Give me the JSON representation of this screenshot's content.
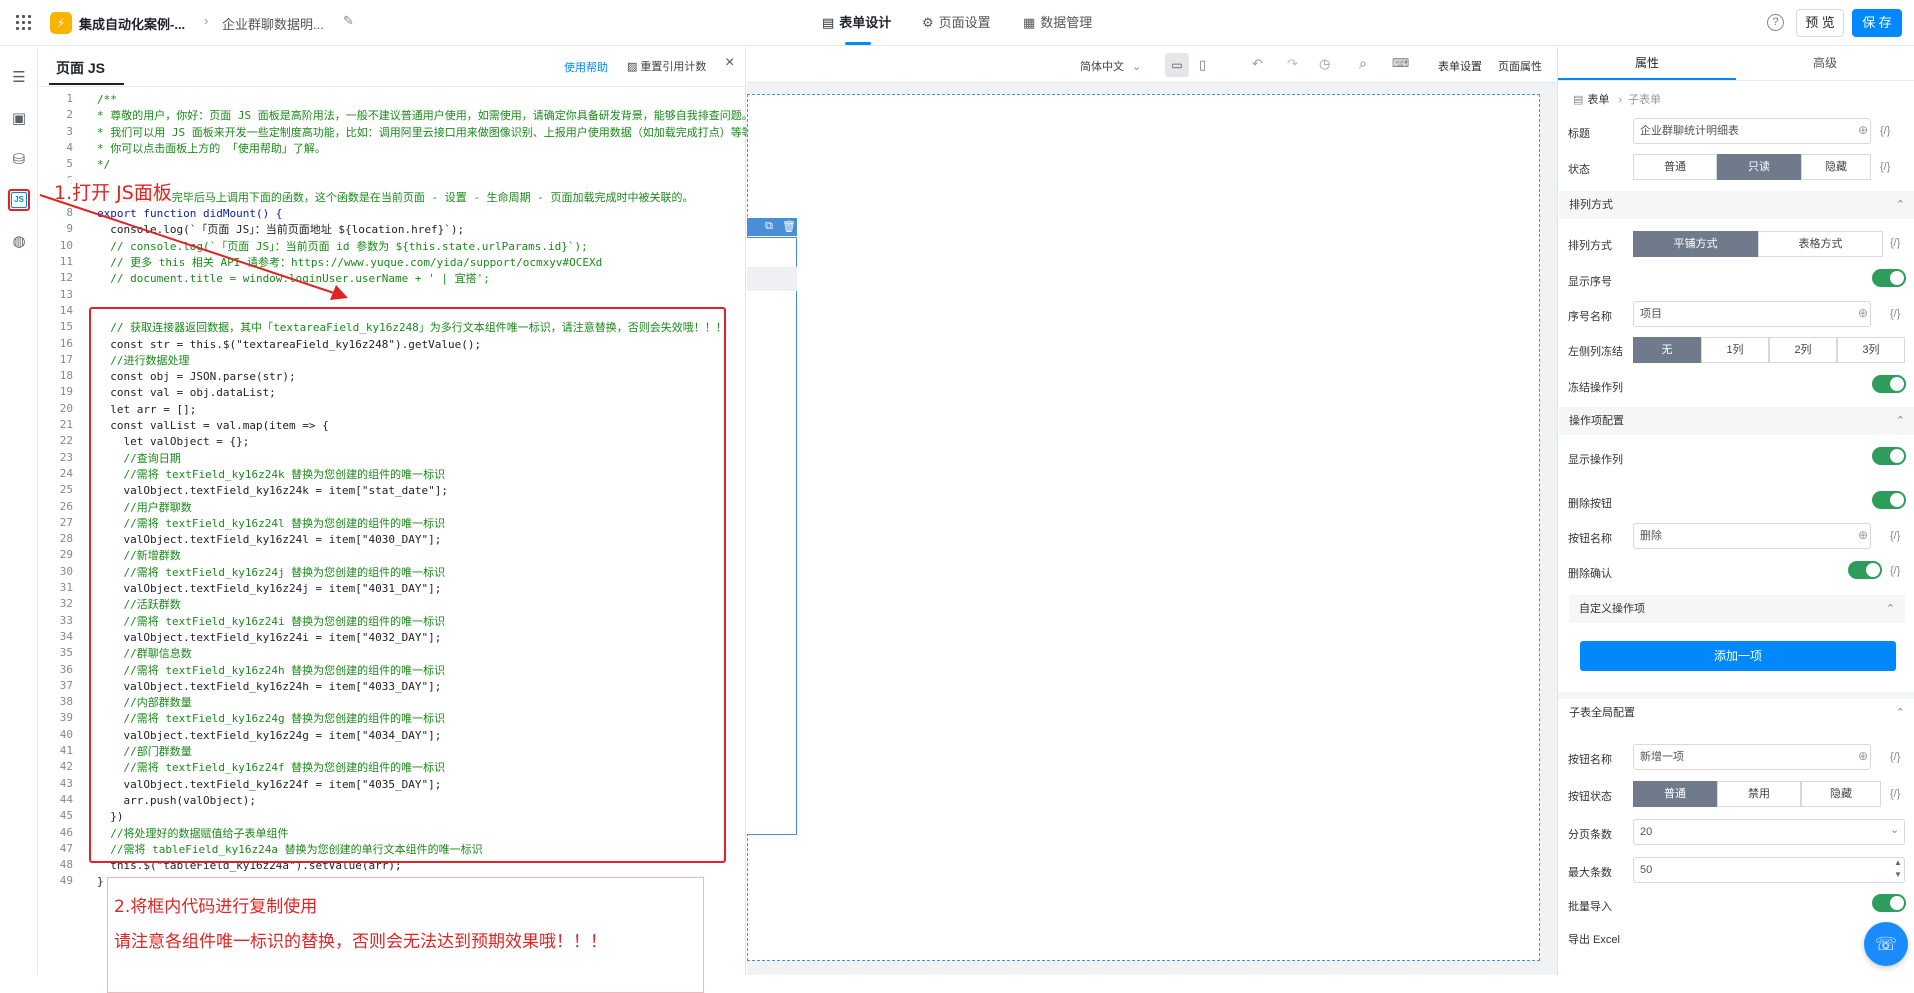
{
  "topbar": {
    "app_name": "集成自动化案例-...",
    "form_name": "企业群聊数据明...",
    "tabs": [
      "表单设计",
      "页面设置",
      "数据管理"
    ],
    "help_glyph": "?",
    "preview_label": "预 览",
    "save_label": "保 存"
  },
  "jspanel": {
    "title": "页面 JS",
    "help_link": "使用帮助",
    "reset_label": "重置引用计数",
    "close_glyph": "×",
    "line_numbers": [
      "1",
      "2",
      "3",
      "4",
      "5",
      "6",
      "7",
      "8",
      "9",
      "10",
      "11",
      "12",
      "13",
      "14",
      "15",
      "16",
      "17",
      "18",
      "19",
      "20",
      "21",
      "22",
      "23",
      "24",
      "25",
      "26",
      "27",
      "28",
      "29",
      "30",
      "31",
      "32",
      "33",
      "34",
      "35",
      "36",
      "37",
      "38",
      "39",
      "40",
      "41",
      "42",
      "43",
      "44",
      "45",
      "46",
      "47",
      "48",
      "49"
    ],
    "code": [
      {
        "t": "/**",
        "c": "cm"
      },
      {
        "t": "* 尊敬的用户，你好：页面 JS 面板是高阶用法，一般不建议普通用户使用，如需使用，请确定你具备研发背景，能够自我排查问题。当",
        "c": "cm"
      },
      {
        "t": "* 我们可以用 JS 面板来开发一些定制度高功能，比如：调用阿里云接口用来做图像识别、上报用户使用数据（如加载完成打点）等等。",
        "c": "cm"
      },
      {
        "t": "* 你可以点击面板上方的 「使用帮助」了解。",
        "c": "cm"
      },
      {
        "t": "*/",
        "c": "cm"
      },
      {
        "t": "",
        "c": ""
      },
      {
        "t": "// 当页面渲染完毕后马上调用下面的函数，这个函数是在当前页面 - 设置 - 生命周期 - 页面加载完成时中被关联的。",
        "c": "cm"
      },
      {
        "t": "export function didMount() {",
        "c": "kw"
      },
      {
        "t": "  console.log(`「页面 JS」：当前页面地址 ${location.href}`);",
        "c": ""
      },
      {
        "t": "  // console.log(`「页面 JS」：当前页面 id 参数为 ${this.state.urlParams.id}`);",
        "c": "cm"
      },
      {
        "t": "  // 更多 this 相关 API 请参考：https://www.yuque.com/yida/support/ocmxyv#OCEXd",
        "c": "cm"
      },
      {
        "t": "  // document.title = window.loginUser.userName + ' | 宜搭';",
        "c": "cm"
      },
      {
        "t": "",
        "c": ""
      },
      {
        "t": "",
        "c": ""
      },
      {
        "t": "  // 获取连接器返回数据，其中「textareaField_ky16z248」为多行文本组件唯一标识，请注意替换，否则会失效哦！！！",
        "c": "cm"
      },
      {
        "t": "  const str = this.$(\"textareaField_ky16z248\").getValue();",
        "c": ""
      },
      {
        "t": "  //进行数据处理",
        "c": "cm"
      },
      {
        "t": "  const obj = JSON.parse(str);",
        "c": ""
      },
      {
        "t": "  const val = obj.dataList;",
        "c": ""
      },
      {
        "t": "  let arr = [];",
        "c": ""
      },
      {
        "t": "  const valList = val.map(item => {",
        "c": ""
      },
      {
        "t": "    let valObject = {};",
        "c": ""
      },
      {
        "t": "    //查询日期",
        "c": "cm"
      },
      {
        "t": "    //需将 textField_ky16z24k 替换为您创建的组件的唯一标识",
        "c": "cm"
      },
      {
        "t": "    valObject.textField_ky16z24k = item[\"stat_date\"];",
        "c": ""
      },
      {
        "t": "    //用户群聊数",
        "c": "cm"
      },
      {
        "t": "    //需将 textField_ky16z24l 替换为您创建的组件的唯一标识",
        "c": "cm"
      },
      {
        "t": "    valObject.textField_ky16z24l = item[\"4030_DAY\"];",
        "c": ""
      },
      {
        "t": "    //新增群数",
        "c": "cm"
      },
      {
        "t": "    //需将 textField_ky16z24j 替换为您创建的组件的唯一标识",
        "c": "cm"
      },
      {
        "t": "    valObject.textField_ky16z24j = item[\"4031_DAY\"];",
        "c": ""
      },
      {
        "t": "    //活跃群数",
        "c": "cm"
      },
      {
        "t": "    //需将 textField_ky16z24i 替换为您创建的组件的唯一标识",
        "c": "cm"
      },
      {
        "t": "    valObject.textField_ky16z24i = item[\"4032_DAY\"];",
        "c": ""
      },
      {
        "t": "    //群聊信息数",
        "c": "cm"
      },
      {
        "t": "    //需将 textField_ky16z24h 替换为您创建的组件的唯一标识",
        "c": "cm"
      },
      {
        "t": "    valObject.textField_ky16z24h = item[\"4033_DAY\"];",
        "c": ""
      },
      {
        "t": "    //内部群数量",
        "c": "cm"
      },
      {
        "t": "    //需将 textField_ky16z24g 替换为您创建的组件的唯一标识",
        "c": "cm"
      },
      {
        "t": "    valObject.textField_ky16z24g = item[\"4034_DAY\"];",
        "c": ""
      },
      {
        "t": "    //部门群数量",
        "c": "cm"
      },
      {
        "t": "    //需将 textField_ky16z24f 替换为您创建的组件的唯一标识",
        "c": "cm"
      },
      {
        "t": "    valObject.textField_ky16z24f = item[\"4035_DAY\"];",
        "c": ""
      },
      {
        "t": "    arr.push(valObject);",
        "c": ""
      },
      {
        "t": "  })",
        "c": ""
      },
      {
        "t": "  //将处理好的数据赋值给子表单组件",
        "c": "cm"
      },
      {
        "t": "  //需将 tableField_ky16z24a 替换为您创建的单行文本组件的唯一标识",
        "c": "cm"
      },
      {
        "t": "  this.$(\"tableField_ky16z24a\").setValue(arr);",
        "c": ""
      },
      {
        "t": "}",
        "c": ""
      }
    ]
  },
  "annotations": {
    "step1": "1.打开 JS面板",
    "step2": "2.将框内代码进行复制使用",
    "note": "请注意各组件唯一标识的替换，否则会无法达到预期效果哦！！！"
  },
  "canvas_toolbar": {
    "language": "简体中文",
    "form_settings": "表单设置",
    "page_props": "页面属性"
  },
  "props": {
    "tabs": [
      "属性",
      "高级"
    ],
    "breadcrumb": [
      "表单",
      "子表单"
    ],
    "title_label": "标题",
    "title_value": "企业群聊统计明细表",
    "state_label": "状态",
    "state_options": [
      "普通",
      "只读",
      "隐藏"
    ],
    "layout_section": "排列方式",
    "layout_label": "排列方式",
    "layout_options": [
      "平铺方式",
      "表格方式"
    ],
    "show_index_label": "显示序号",
    "index_name_label": "序号名称",
    "index_name_value": "项目",
    "freeze_left_label": "左侧列冻结",
    "freeze_left_options": [
      "无",
      "1列",
      "2列",
      "3列"
    ],
    "freeze_action_label": "冻结操作列",
    "action_section": "操作项配置",
    "show_action_label": "显示操作列",
    "delete_button_label": "删除按钮",
    "button_name_label": "按钮名称",
    "button_name_value": "删除",
    "delete_confirm_label": "删除确认",
    "custom_action_section": "自定义操作项",
    "add_item_label": "添加一项",
    "global_section": "子表全局配置",
    "global_button_name_label": "按钮名称",
    "global_button_name_value": "新增一项",
    "button_state_label": "按钮状态",
    "button_state_options": [
      "普通",
      "禁用",
      "隐藏"
    ],
    "page_size_label": "分页条数",
    "page_size_value": "20",
    "max_items_label": "最大条数",
    "max_items_value": "50",
    "bulk_import_label": "批量导入",
    "export_label": "导出 Excel",
    "fx_glyph": "{/}"
  },
  "colors": {
    "accent": "#0089ff",
    "annotation_red": "#e02424",
    "toggle_on": "#2e9c5a",
    "segment_on": "#6f7b8a"
  }
}
